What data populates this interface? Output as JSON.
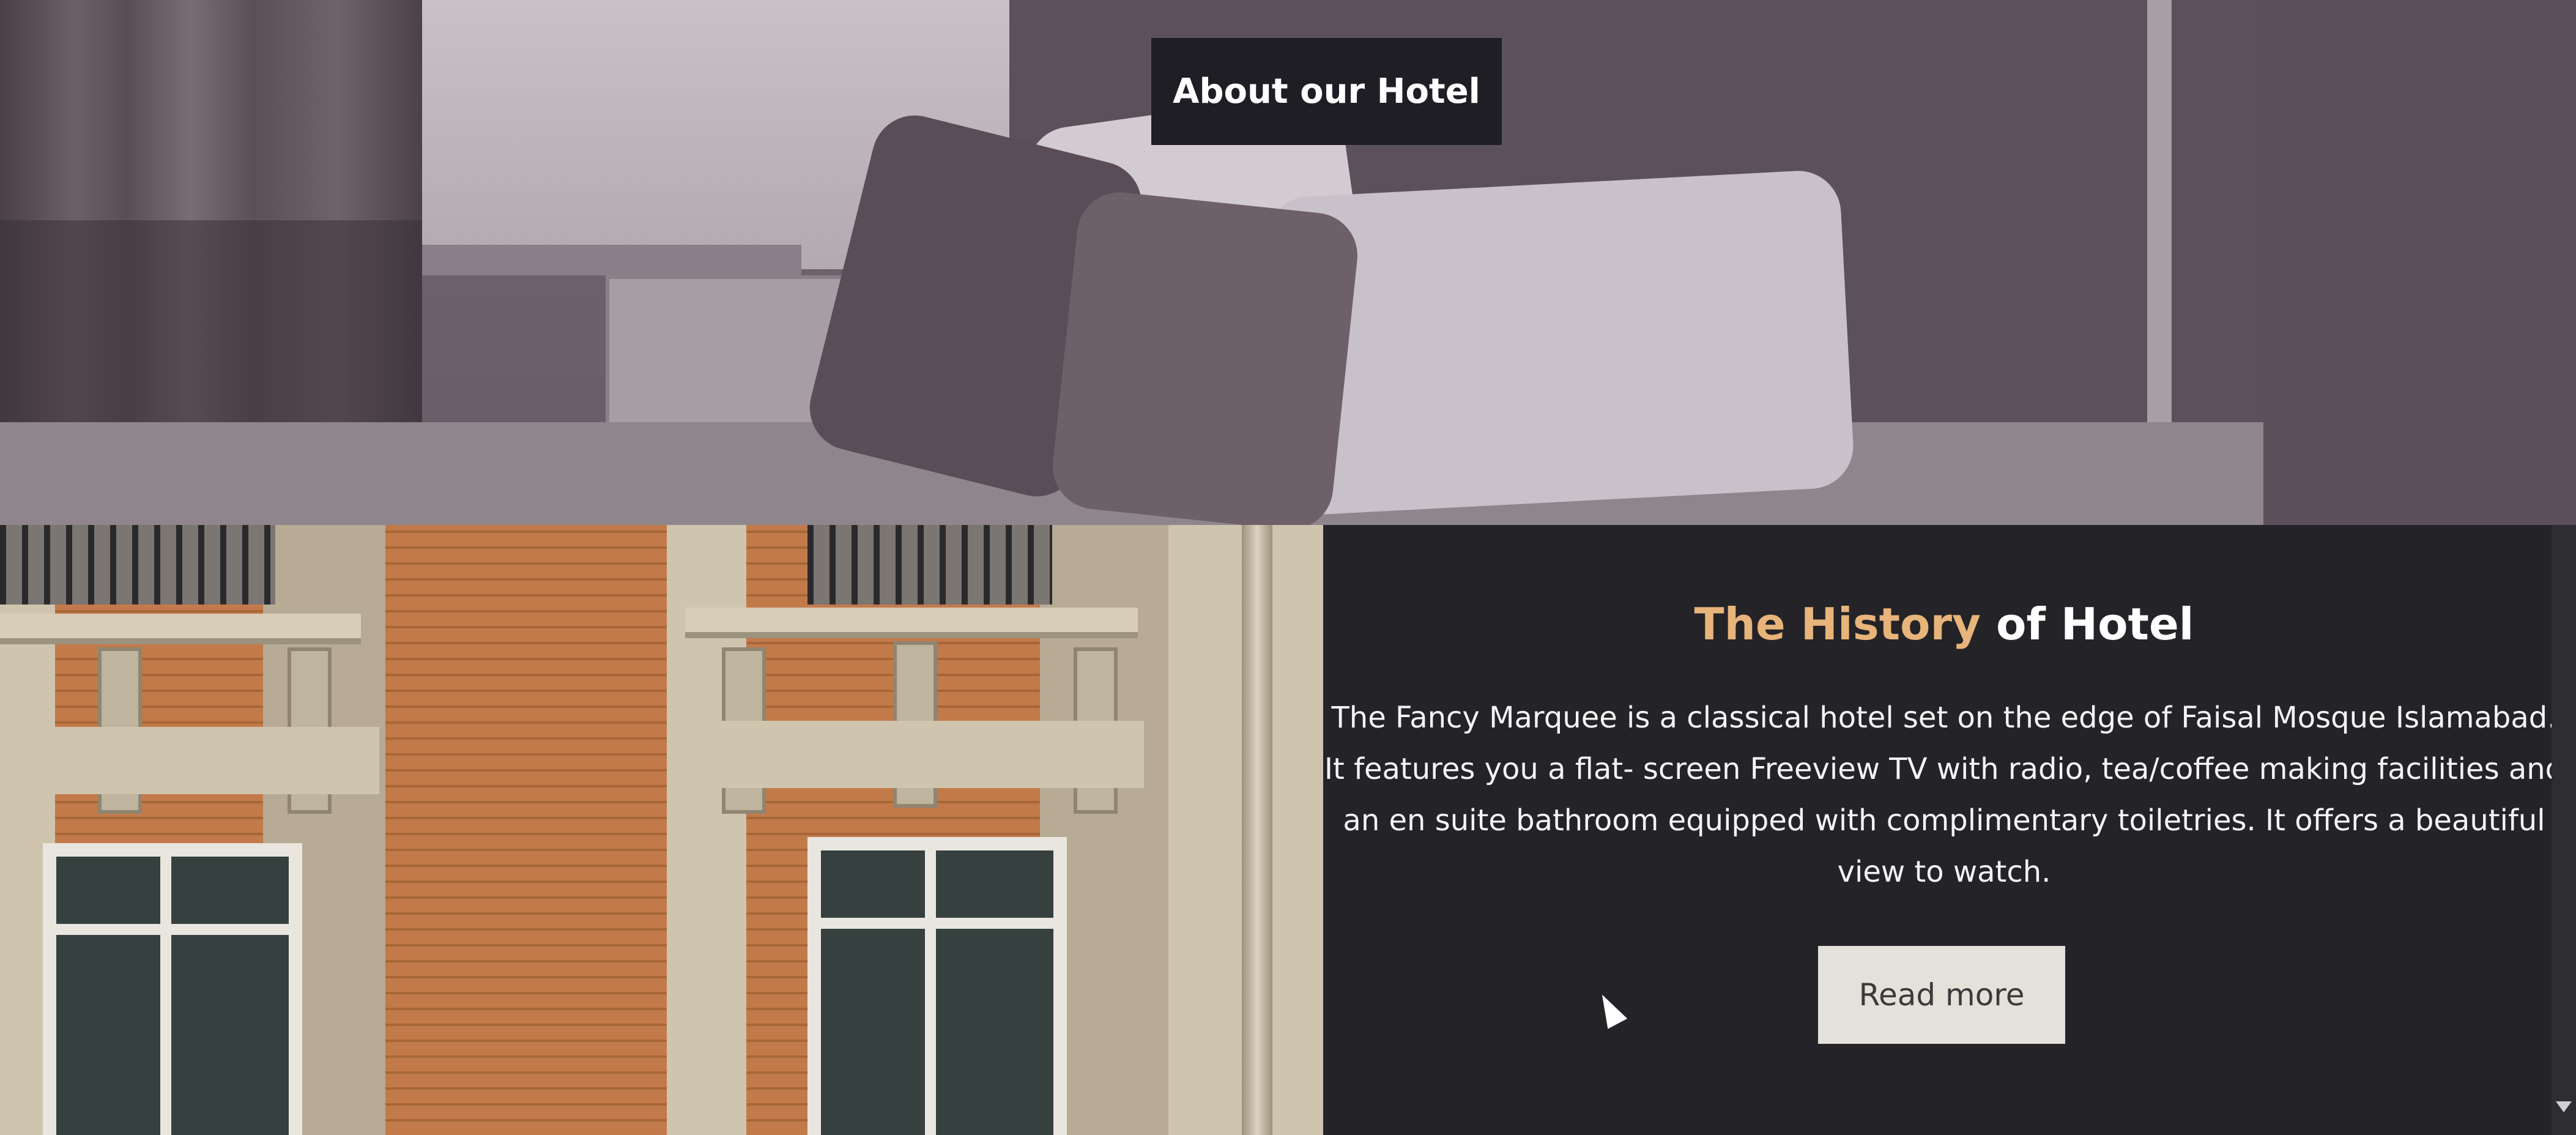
{
  "hero": {
    "button_label": "About our Hotel"
  },
  "history": {
    "title_accent": "The History",
    "title_rest": " of Hotel",
    "body": "The Fancy Marquee is a classical hotel set on the edge of Faisal Mosque Islamabad. It features you a flat- screen Freeview TV with radio, tea/coffee making facilities and an en suite bathroom equipped with complimentary toiletries. It offers a beautiful view to watch.",
    "read_more_label": "Read more"
  },
  "colors": {
    "accent": "#e7b47a",
    "panel_bg": "#242328",
    "button_dark": "#1f1e24",
    "button_light": "#e4e0da"
  },
  "icons": {
    "cursor": "mouse-pointer-icon",
    "scroll": "scroll-down-arrow-icon"
  }
}
